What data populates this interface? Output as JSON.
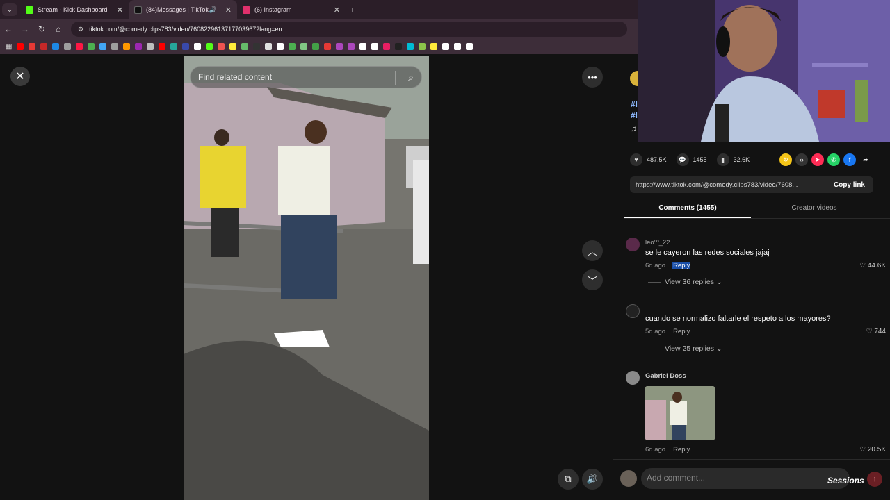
{
  "browser": {
    "tabs": [
      {
        "title": "Stream - Kick Dashboard",
        "favicon_color": "#53fc18",
        "favicon_glyph": "K",
        "active": false
      },
      {
        "title": "(84)Messages | TikTok",
        "favicon_color": "#111111",
        "favicon_glyph": "♪",
        "active": true
      },
      {
        "title": "(6) Instagram",
        "favicon_color": "#e1306c",
        "favicon_glyph": "◎",
        "active": false
      }
    ],
    "close_glyph": "✕",
    "url": "tiktok.com/@comedy.clips783/video/7608229613717703967?lang=en",
    "bookmark_colors": [
      "#ff0000",
      "#e53935",
      "#c62828",
      "#1e88e5",
      "#9e9e9e",
      "#ff1744",
      "#4caf50",
      "#42a5f5",
      "#9e9e9e",
      "#ff9800",
      "#9c27b0",
      "#bdbdbd",
      "#ff0000",
      "#26a69a",
      "#3949ab",
      "#ffffff",
      "#53fc18",
      "#ef5350",
      "#ffeb3b",
      "#66bb6a",
      "#333333",
      "#e0e0e0",
      "#ffffff",
      "#4caf50",
      "#81c784",
      "#43a047",
      "#e53935",
      "#ab47bc",
      "#ab47bc",
      "#ffffff",
      "#ffffff",
      "#e91e63",
      "#212121",
      "#00bcd4",
      "#8bc34a",
      "#ffeb3b",
      "#ffffff",
      "#ffffff",
      "#ffffff"
    ]
  },
  "video": {
    "search_placeholder": "Find related content"
  },
  "sidebar": {
    "caption_fragments": [
      "#l",
      "#l",
      "♫"
    ],
    "stats": {
      "likes": "487.5K",
      "comments": "1455",
      "saves": "32.6K"
    },
    "share_colors": [
      "#f5c518",
      "#333333",
      "#fe2c55",
      "#25d366",
      "#1877f2"
    ],
    "share_link": "https://www.tiktok.com/@comedy.clips783/video/7608...",
    "copy_link_label": "Copy link",
    "tabs": [
      "Comments (1455)",
      "Creator videos"
    ],
    "comments": [
      {
        "user": "leoºº_22",
        "text": "se le cayeron las redes sociales jajaj",
        "time": "6d ago",
        "reply": "Reply",
        "likes": "44.6K",
        "replies": "View 36 replies"
      },
      {
        "user": "",
        "text": "cuando se normalizo faltarle el respeto a los mayores?",
        "time": "5d ago",
        "reply": "Reply",
        "likes": "744",
        "replies": "View 25 replies"
      },
      {
        "user": "Gabriel Doss",
        "text": "",
        "time": "6d ago",
        "reply": "Reply",
        "likes": "20.5K",
        "replies": ""
      }
    ],
    "add_comment_placeholder": "Add comment..."
  },
  "watermark": "Sessions"
}
